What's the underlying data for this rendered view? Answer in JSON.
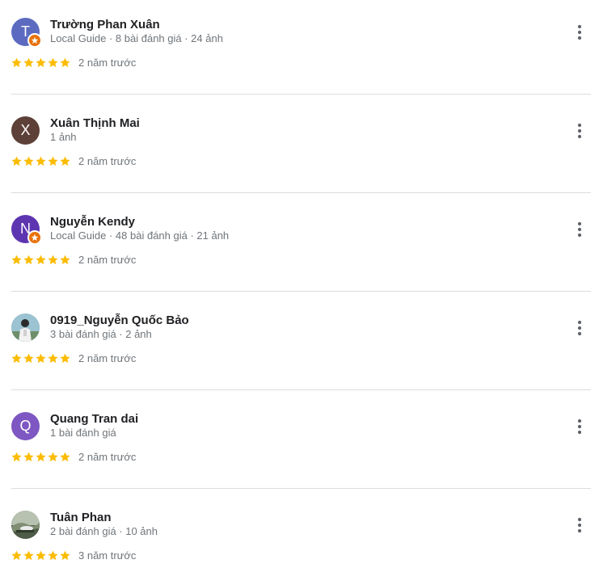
{
  "reviews": [
    {
      "initial": "T",
      "avatar_color": "#5c6bc0",
      "local_guide": true,
      "name": "Trường Phan Xuân",
      "meta": "Local Guide · 8 bài đánh giá · 24 ảnh",
      "rating": 5,
      "date": "2 năm trước"
    },
    {
      "initial": "X",
      "avatar_color": "#5d4037",
      "local_guide": false,
      "name": "Xuân Thịnh Mai",
      "meta": "1 ảnh",
      "rating": 5,
      "date": "2 năm trước"
    },
    {
      "initial": "N",
      "avatar_color": "#5e35b1",
      "local_guide": true,
      "name": "Nguyễn Kendy",
      "meta": "Local Guide · 48 bài đánh giá · 21 ảnh",
      "rating": 5,
      "date": "2 năm trước"
    },
    {
      "initial": "",
      "avatar_color": "#7fa6b8",
      "local_guide": false,
      "photo": "person-photo",
      "name": "0919_Nguyễn Quốc Bảo",
      "meta": "3 bài đánh giá · 2 ảnh",
      "rating": 5,
      "date": "2 năm trước"
    },
    {
      "initial": "Q",
      "avatar_color": "#7e57c2",
      "local_guide": false,
      "name": "Quang Tran dai",
      "meta": "1 bài đánh giá",
      "rating": 5,
      "date": "2 năm trước"
    },
    {
      "initial": "",
      "avatar_color": "#6d7a6a",
      "local_guide": false,
      "photo": "landscape-photo",
      "name": "Tuân Phan",
      "meta": "2 bài đánh giá · 10 ảnh",
      "rating": 5,
      "date": "3 năm trước"
    }
  ],
  "colors": {
    "star": "#fbbc04",
    "star_empty": "#dadce0",
    "menu_dots": "#5f6368",
    "guide_badge": "#e8710a"
  },
  "icons": {
    "menu": "more-vert-icon",
    "star": "star-icon",
    "guide": "local-guide-badge-icon"
  }
}
